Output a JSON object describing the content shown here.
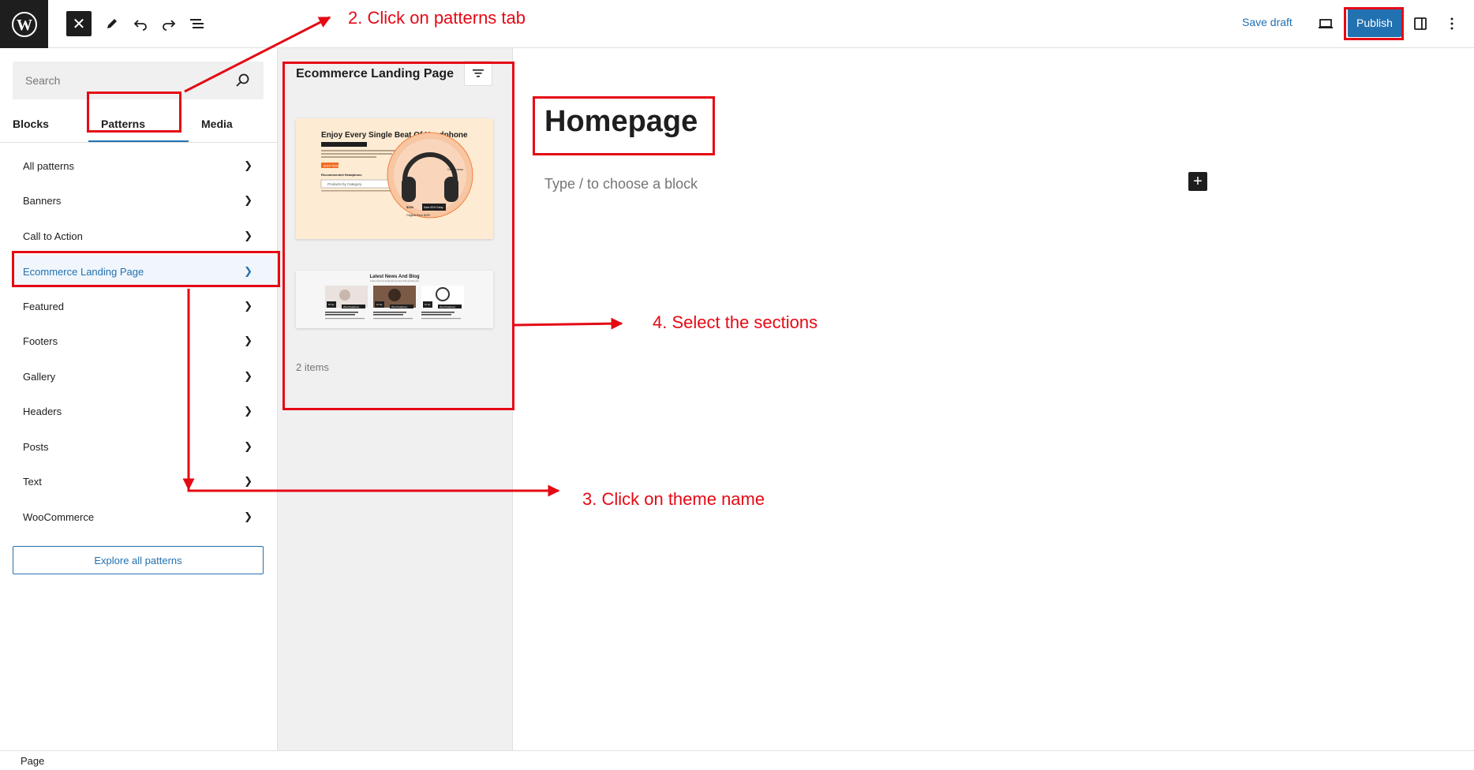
{
  "topbar": {
    "save_draft": "Save draft",
    "publish": "Publish"
  },
  "sidebar": {
    "search_placeholder": "Search",
    "tabs": [
      "Blocks",
      "Patterns",
      "Media"
    ],
    "categories": [
      "All patterns",
      "Banners",
      "Call to Action",
      "Ecommerce Landing Page",
      "Featured",
      "Footers",
      "Gallery",
      "Headers",
      "Posts",
      "Text",
      "WooCommerce"
    ],
    "active_category": "Ecommerce Landing Page",
    "explore_button": "Explore all patterns"
  },
  "patterns_panel": {
    "title": "Ecommerce Landing Page",
    "items_count": "2 items",
    "hero_preview": {
      "heading": "Enjoy Every Single Beat Of Headphone",
      "button": "SHOP NOW",
      "section_label": "Recommended Headphone",
      "category_field": "Products by Category",
      "price": "$200",
      "badge": "Save 30% Today",
      "original_price": "Original Price $299",
      "reviews": "Our Reviews"
    },
    "blog_preview": {
      "heading": "Latest News And Blog",
      "subheading": "Lorem Ipsum is simply dummy text of the printing and",
      "cards": [
        {
          "tag": "Wired Headphone",
          "date": "25 Jan"
        },
        {
          "tag": "Wired Headphone",
          "date": "25 Jan"
        },
        {
          "tag": "Wired Headphone",
          "date": "25 Jan"
        }
      ]
    }
  },
  "canvas": {
    "page_title": "Homepage",
    "block_placeholder": "Type / to choose a block"
  },
  "statusbar": {
    "label": "Page"
  },
  "annotations": {
    "step2": "2. Click on patterns tab",
    "step3": "3. Click on theme name",
    "step4": "4. Select the sections",
    "color": "#e50914"
  },
  "colors": {
    "accent": "#2271b1",
    "dark": "#1e1e1e",
    "panel_bg": "#f0f0f0",
    "hero_bg": "#fdebd3",
    "hero_orange": "#f26b21"
  }
}
